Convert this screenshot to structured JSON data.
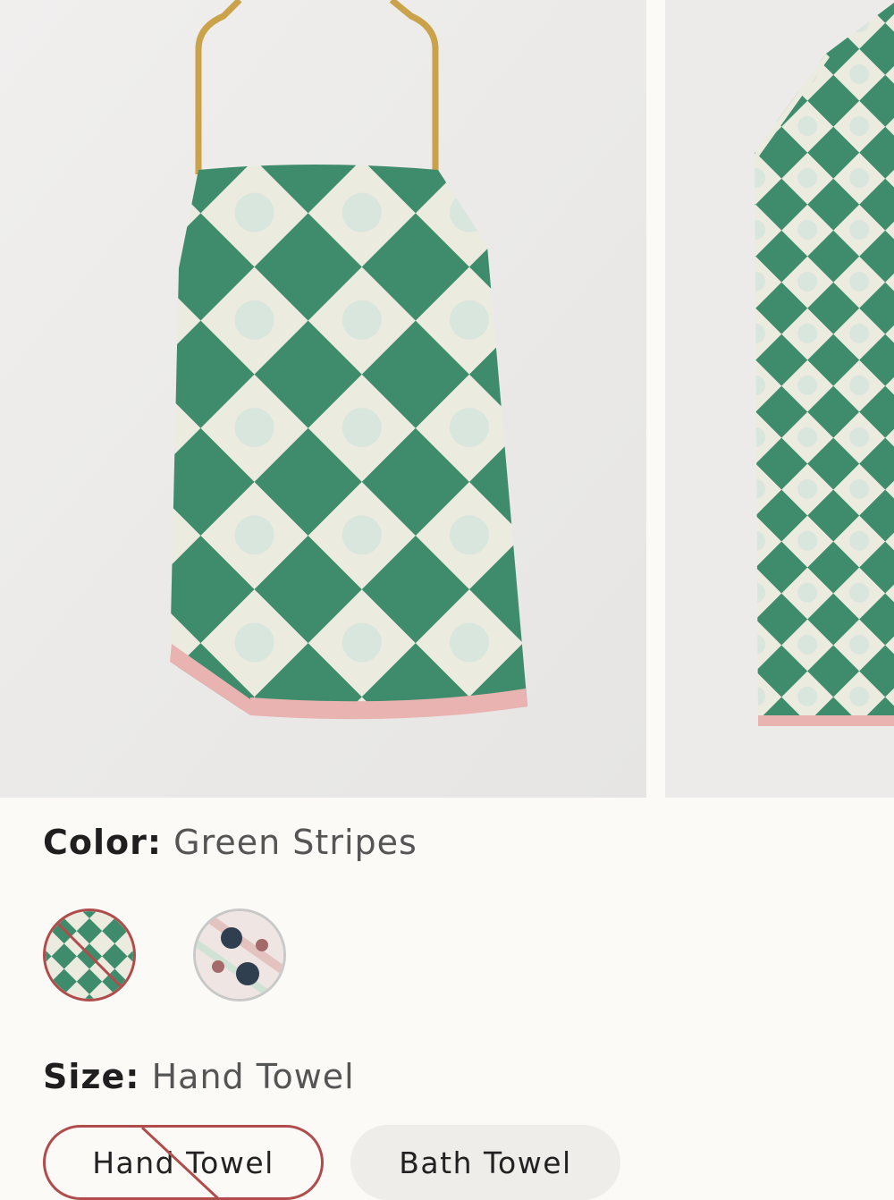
{
  "product_gallery": {
    "main_image_alt": "",
    "second_image_alt": ""
  },
  "color": {
    "label": "Color:",
    "value": "Green Stripes",
    "swatches": [
      {
        "name": "Green",
        "unavailable": true,
        "accent": "#3f8c6c"
      },
      {
        "name": "Floral",
        "unavailable": false,
        "accent": "#c9a9a6"
      }
    ]
  },
  "size": {
    "label": "Size:",
    "value": "Hand Towel",
    "options": [
      {
        "label": "Hand Towel",
        "unavailable": true
      },
      {
        "label": "Bath Towel",
        "unavailable": false
      }
    ]
  },
  "colors": {
    "towel_green": "#3f8c6c",
    "towel_cream": "#ecebe0",
    "trim_pink": "#e9b3b2",
    "strike_red": "#b14c4c"
  }
}
